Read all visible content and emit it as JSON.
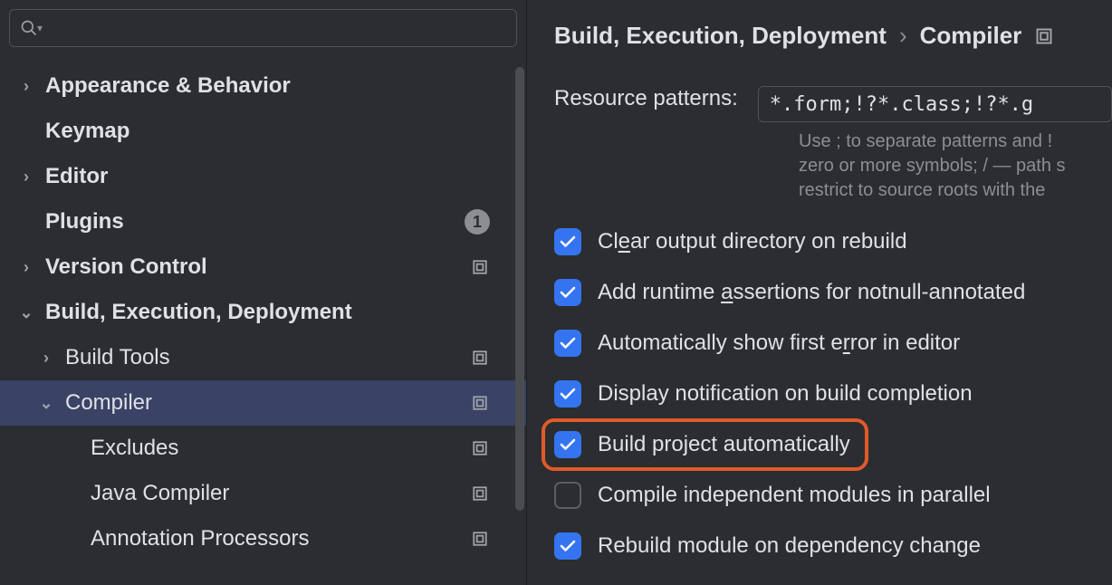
{
  "search": {
    "placeholder": ""
  },
  "sidebar": {
    "items": [
      {
        "label": "Appearance & Behavior",
        "arrow": "right",
        "depth": 0
      },
      {
        "label": "Keymap",
        "arrow": "none",
        "depth": 0
      },
      {
        "label": "Editor",
        "arrow": "right",
        "depth": 0
      },
      {
        "label": "Plugins",
        "arrow": "none",
        "depth": 0,
        "badge": "1"
      },
      {
        "label": "Version Control",
        "arrow": "right",
        "depth": 0,
        "block": true
      },
      {
        "label": "Build, Execution, Deployment",
        "arrow": "down",
        "depth": 0
      },
      {
        "label": "Build Tools",
        "arrow": "right",
        "depth": 1,
        "block": true
      },
      {
        "label": "Compiler",
        "arrow": "down",
        "depth": 1,
        "block": true,
        "selected": true
      },
      {
        "label": "Excludes",
        "arrow": "none",
        "depth": 2,
        "block": true
      },
      {
        "label": "Java Compiler",
        "arrow": "none",
        "depth": 2,
        "block": true
      },
      {
        "label": "Annotation Processors",
        "arrow": "none",
        "depth": 2,
        "block": true
      }
    ]
  },
  "breadcrumb": {
    "parent": "Build, Execution, Deployment",
    "current": "Compiler"
  },
  "fields": {
    "resource_patterns_label": "Resource patterns:",
    "resource_patterns_value": "*.form;!?*.class;!?*.g",
    "hint_line1": "Use ; to separate patterns and ! ",
    "hint_line2": "zero or more symbols; / — path s",
    "hint_line3": "restrict to source roots with the "
  },
  "checks": [
    {
      "label_pre": "Cl",
      "mn": "e",
      "label_post": "ar output directory on rebuild",
      "checked": true
    },
    {
      "label_pre": "Add runtime ",
      "mn": "a",
      "label_post": "ssertions for notnull-annotated ",
      "checked": true
    },
    {
      "label_pre": "Automatically show first e",
      "mn": "r",
      "label_post": "ror in editor",
      "checked": true
    },
    {
      "label_pre": "Display notification on build completion",
      "mn": "",
      "label_post": "",
      "checked": true
    },
    {
      "label_pre": "Build project automatically",
      "mn": "",
      "label_post": "",
      "checked": true,
      "highlight": true
    },
    {
      "label_pre": "Compile independent modules in parallel",
      "mn": "",
      "label_post": "",
      "checked": false
    },
    {
      "label_pre": "Rebuild module on dependency change",
      "mn": "",
      "label_post": "",
      "checked": true
    }
  ]
}
